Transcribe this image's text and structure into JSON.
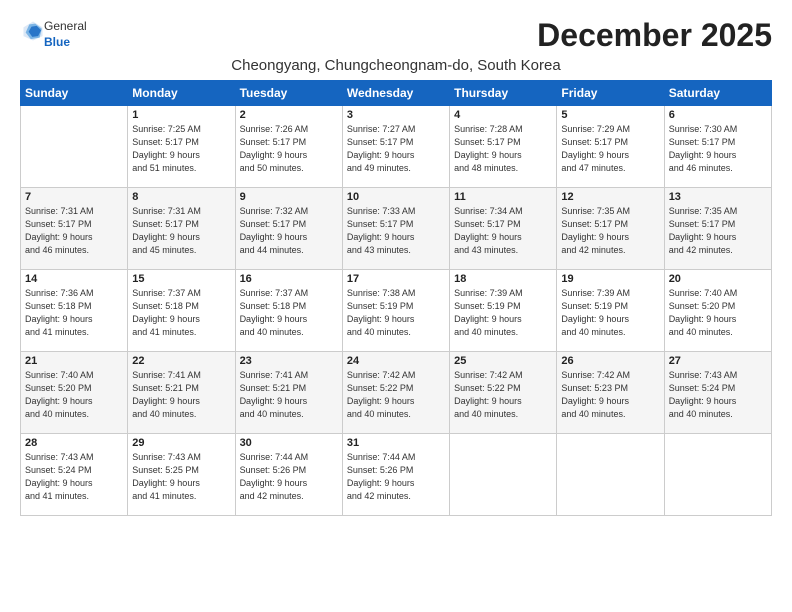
{
  "logo": {
    "general": "General",
    "blue": "Blue"
  },
  "header": {
    "month": "December 2025",
    "location": "Cheongyang, Chungcheongnam-do, South Korea"
  },
  "weekdays": [
    "Sunday",
    "Monday",
    "Tuesday",
    "Wednesday",
    "Thursday",
    "Friday",
    "Saturday"
  ],
  "weeks": [
    [
      {
        "day": "",
        "info": ""
      },
      {
        "day": "1",
        "info": "Sunrise: 7:25 AM\nSunset: 5:17 PM\nDaylight: 9 hours\nand 51 minutes."
      },
      {
        "day": "2",
        "info": "Sunrise: 7:26 AM\nSunset: 5:17 PM\nDaylight: 9 hours\nand 50 minutes."
      },
      {
        "day": "3",
        "info": "Sunrise: 7:27 AM\nSunset: 5:17 PM\nDaylight: 9 hours\nand 49 minutes."
      },
      {
        "day": "4",
        "info": "Sunrise: 7:28 AM\nSunset: 5:17 PM\nDaylight: 9 hours\nand 48 minutes."
      },
      {
        "day": "5",
        "info": "Sunrise: 7:29 AM\nSunset: 5:17 PM\nDaylight: 9 hours\nand 47 minutes."
      },
      {
        "day": "6",
        "info": "Sunrise: 7:30 AM\nSunset: 5:17 PM\nDaylight: 9 hours\nand 46 minutes."
      }
    ],
    [
      {
        "day": "7",
        "info": "Sunrise: 7:31 AM\nSunset: 5:17 PM\nDaylight: 9 hours\nand 46 minutes."
      },
      {
        "day": "8",
        "info": "Sunrise: 7:31 AM\nSunset: 5:17 PM\nDaylight: 9 hours\nand 45 minutes."
      },
      {
        "day": "9",
        "info": "Sunrise: 7:32 AM\nSunset: 5:17 PM\nDaylight: 9 hours\nand 44 minutes."
      },
      {
        "day": "10",
        "info": "Sunrise: 7:33 AM\nSunset: 5:17 PM\nDaylight: 9 hours\nand 43 minutes."
      },
      {
        "day": "11",
        "info": "Sunrise: 7:34 AM\nSunset: 5:17 PM\nDaylight: 9 hours\nand 43 minutes."
      },
      {
        "day": "12",
        "info": "Sunrise: 7:35 AM\nSunset: 5:17 PM\nDaylight: 9 hours\nand 42 minutes."
      },
      {
        "day": "13",
        "info": "Sunrise: 7:35 AM\nSunset: 5:17 PM\nDaylight: 9 hours\nand 42 minutes."
      }
    ],
    [
      {
        "day": "14",
        "info": "Sunrise: 7:36 AM\nSunset: 5:18 PM\nDaylight: 9 hours\nand 41 minutes."
      },
      {
        "day": "15",
        "info": "Sunrise: 7:37 AM\nSunset: 5:18 PM\nDaylight: 9 hours\nand 41 minutes."
      },
      {
        "day": "16",
        "info": "Sunrise: 7:37 AM\nSunset: 5:18 PM\nDaylight: 9 hours\nand 40 minutes."
      },
      {
        "day": "17",
        "info": "Sunrise: 7:38 AM\nSunset: 5:19 PM\nDaylight: 9 hours\nand 40 minutes."
      },
      {
        "day": "18",
        "info": "Sunrise: 7:39 AM\nSunset: 5:19 PM\nDaylight: 9 hours\nand 40 minutes."
      },
      {
        "day": "19",
        "info": "Sunrise: 7:39 AM\nSunset: 5:19 PM\nDaylight: 9 hours\nand 40 minutes."
      },
      {
        "day": "20",
        "info": "Sunrise: 7:40 AM\nSunset: 5:20 PM\nDaylight: 9 hours\nand 40 minutes."
      }
    ],
    [
      {
        "day": "21",
        "info": "Sunrise: 7:40 AM\nSunset: 5:20 PM\nDaylight: 9 hours\nand 40 minutes."
      },
      {
        "day": "22",
        "info": "Sunrise: 7:41 AM\nSunset: 5:21 PM\nDaylight: 9 hours\nand 40 minutes."
      },
      {
        "day": "23",
        "info": "Sunrise: 7:41 AM\nSunset: 5:21 PM\nDaylight: 9 hours\nand 40 minutes."
      },
      {
        "day": "24",
        "info": "Sunrise: 7:42 AM\nSunset: 5:22 PM\nDaylight: 9 hours\nand 40 minutes."
      },
      {
        "day": "25",
        "info": "Sunrise: 7:42 AM\nSunset: 5:22 PM\nDaylight: 9 hours\nand 40 minutes."
      },
      {
        "day": "26",
        "info": "Sunrise: 7:42 AM\nSunset: 5:23 PM\nDaylight: 9 hours\nand 40 minutes."
      },
      {
        "day": "27",
        "info": "Sunrise: 7:43 AM\nSunset: 5:24 PM\nDaylight: 9 hours\nand 40 minutes."
      }
    ],
    [
      {
        "day": "28",
        "info": "Sunrise: 7:43 AM\nSunset: 5:24 PM\nDaylight: 9 hours\nand 41 minutes."
      },
      {
        "day": "29",
        "info": "Sunrise: 7:43 AM\nSunset: 5:25 PM\nDaylight: 9 hours\nand 41 minutes."
      },
      {
        "day": "30",
        "info": "Sunrise: 7:44 AM\nSunset: 5:26 PM\nDaylight: 9 hours\nand 42 minutes."
      },
      {
        "day": "31",
        "info": "Sunrise: 7:44 AM\nSunset: 5:26 PM\nDaylight: 9 hours\nand 42 minutes."
      },
      {
        "day": "",
        "info": ""
      },
      {
        "day": "",
        "info": ""
      },
      {
        "day": "",
        "info": ""
      }
    ]
  ]
}
